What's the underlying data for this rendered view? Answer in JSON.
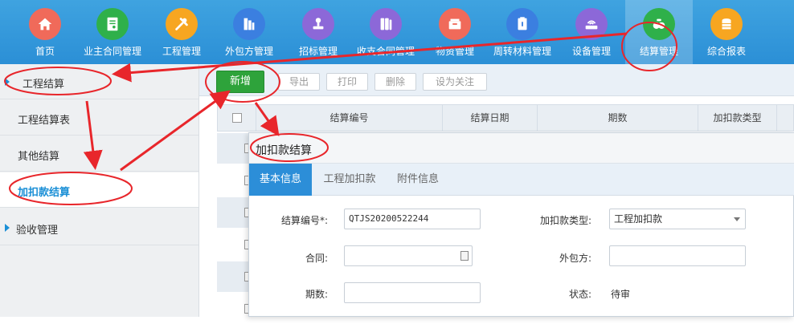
{
  "nav": {
    "items": [
      {
        "label": "首页",
        "icon": "home-icon",
        "color": "#f06a5a"
      },
      {
        "label": "业主合同管理",
        "icon": "contract-icon",
        "color": "#2fb04a"
      },
      {
        "label": "工程管理",
        "icon": "wrench-icon",
        "color": "#f7a621"
      },
      {
        "label": "外包方管理",
        "icon": "building-icon",
        "color": "#3b7fe0"
      },
      {
        "label": "招标管理",
        "icon": "stamp-icon",
        "color": "#8c68d8"
      },
      {
        "label": "收支合同管理",
        "icon": "folder-icon",
        "color": "#8c68d8"
      },
      {
        "label": "物资管理",
        "icon": "box-icon",
        "color": "#f06a5a"
      },
      {
        "label": "周转材料管理",
        "icon": "clipboard-icon",
        "color": "#3b7fe0"
      },
      {
        "label": "设备管理",
        "icon": "router-icon",
        "color": "#8c68d8"
      },
      {
        "label": "结算管理",
        "icon": "money-bag-icon",
        "color": "#2fb04a"
      },
      {
        "label": "综合报表",
        "icon": "coins-icon",
        "color": "#f7a621"
      }
    ]
  },
  "sidebar": {
    "items": [
      {
        "label": "工程结算"
      },
      {
        "label": "工程结算表"
      },
      {
        "label": "其他结算"
      },
      {
        "label": "加扣款结算"
      },
      {
        "label": "验收管理"
      }
    ]
  },
  "toolbar": {
    "new_label": "新增",
    "export_label": "导出",
    "print_label": "打印",
    "delete_label": "删除",
    "follow_label": "设为关注"
  },
  "table": {
    "columns": [
      "结算编号",
      "结算日期",
      "期数",
      "加扣款类型"
    ]
  },
  "modal": {
    "title": "加扣款结算",
    "tabs": [
      "基本信息",
      "工程加扣款",
      "附件信息"
    ],
    "fields": {
      "code_label": "结算编号*:",
      "code_value": "QTJS20200522244",
      "type_label": "加扣款类型:",
      "type_value": "工程加扣款",
      "contract_label": "合同:",
      "contract_value": "",
      "vendor_label": "外包方:",
      "vendor_value": "",
      "period_label": "期数:",
      "period_value": "",
      "status_label": "状态:",
      "status_value": "待审"
    }
  },
  "colors": {
    "nav_bg": "#2b8fd6",
    "accent": "#1a8fd6",
    "primary_button": "#2ea33b",
    "annotation": "#e8262b"
  }
}
